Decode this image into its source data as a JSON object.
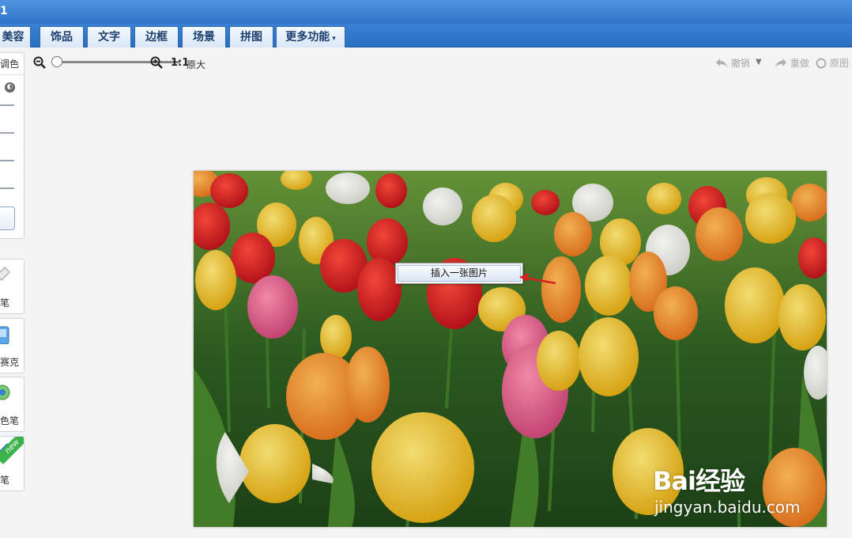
{
  "window": {
    "title": "1"
  },
  "tabs": [
    {
      "label": "美容"
    },
    {
      "label": "饰品"
    },
    {
      "label": "文字"
    },
    {
      "label": "边框"
    },
    {
      "label": "场景"
    },
    {
      "label": "拼图"
    },
    {
      "label": "更多功能",
      "caret": "▾"
    }
  ],
  "left_panel": {
    "section_label": "调色",
    "tools": [
      {
        "label": "笔"
      },
      {
        "label": "赛克"
      },
      {
        "label": "色笔"
      },
      {
        "label": "笔",
        "badge": "new"
      }
    ]
  },
  "zoom": {
    "ratio": "1:1",
    "original_size_label": "原大",
    "level": 0.02
  },
  "toolbar_right": {
    "undo_label": "撤销",
    "undo_caret": "▼",
    "redo_label": "重做",
    "original_label": "原图"
  },
  "context_menu": {
    "item": "插入一张图片"
  },
  "watermark": {
    "brand": "Bai经验",
    "url": "jingyan.baidu.com"
  },
  "colors": {
    "titlebar": "#3b82d4",
    "tab_bg": "#e6f0fb",
    "arrow": "#d42020",
    "canvas_bg": "#f4f4f4"
  }
}
